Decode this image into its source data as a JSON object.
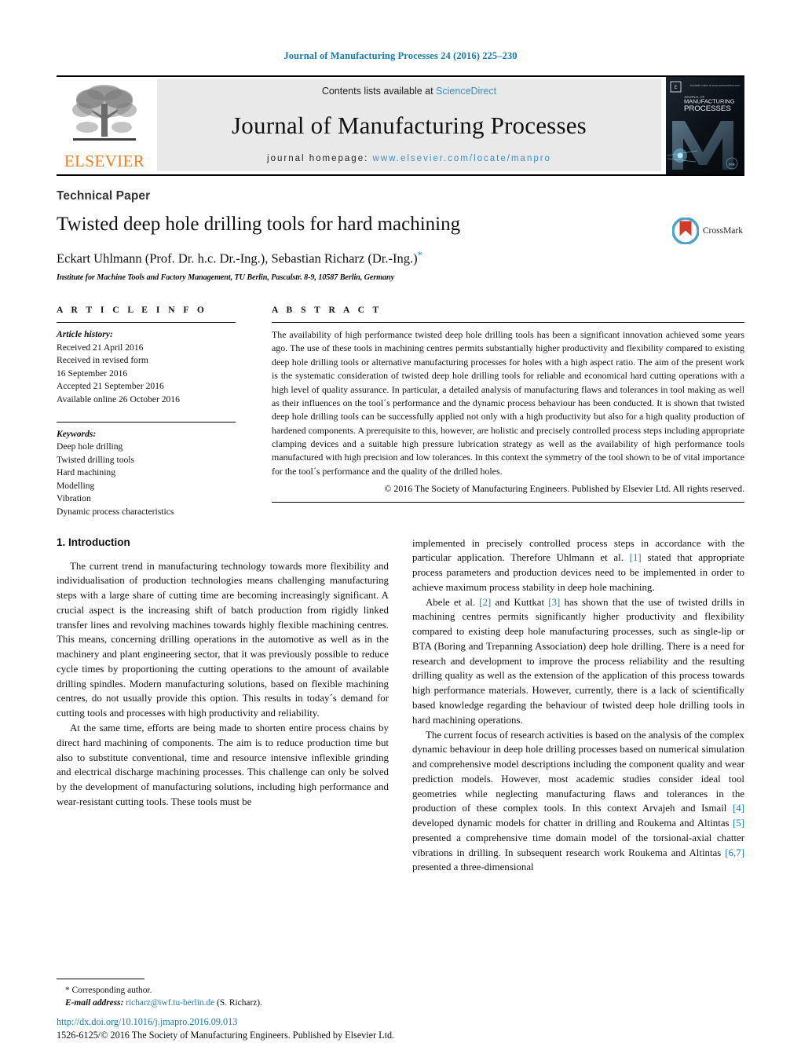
{
  "running_head": "Journal of Manufacturing Processes 24 (2016) 225–230",
  "banner": {
    "publisher_logo_name": "ELSEVIER",
    "contents_prefix": "Contents lists available at ",
    "contents_link": "ScienceDirect",
    "journal_name": "Journal of Manufacturing Processes",
    "homepage_prefix": "journal homepage: ",
    "homepage_url": "www.elsevier.com/locate/manpro",
    "cover_title_line1": "JOURNAL OF",
    "cover_title_line2": "MANUFACTURING",
    "cover_title_line3": "PROCESSES"
  },
  "article": {
    "type": "Technical Paper",
    "title": "Twisted deep hole drilling tools for hard machining",
    "authors": "Eckart Uhlmann (Prof. Dr. h.c. Dr.-Ing.), Sebastian Richarz (Dr.-Ing.)",
    "corresponding_marker": "*",
    "affiliation": "Institute for Machine Tools and Factory Management, TU Berlin, Pascalstr. 8-9, 10587 Berlin, Germany",
    "crossmark_label": "CrossMark"
  },
  "article_info": {
    "heading": "A R T I C L E   I N F O",
    "history_label": "Article history:",
    "history": [
      "Received 21 April 2016",
      "Received in revised form",
      "16 September 2016",
      "Accepted 21 September 2016",
      "Available online 26 October 2016"
    ],
    "keywords_label": "Keywords:",
    "keywords": [
      "Deep hole drilling",
      "Twisted drilling tools",
      "Hard machining",
      "Modelling",
      "Vibration",
      "Dynamic process characteristics"
    ]
  },
  "abstract": {
    "heading": "A B S T R A C T",
    "text": "The availability of high performance twisted deep hole drilling tools has been a significant innovation achieved some years ago. The use of these tools in machining centres permits substantially higher productivity and flexibility compared to existing deep hole drilling tools or alternative manufacturing processes for holes with a high aspect ratio. The aim of the present work is the systematic consideration of twisted deep hole drilling tools for reliable and economical hard cutting operations with a high level of quality assurance. In particular, a detailed analysis of manufacturing flaws and tolerances in tool making as well as their influences on the tool´s performance and the dynamic process behaviour has been conducted. It is shown that twisted deep hole drilling tools can be successfully applied not only with a high productivity but also for a high quality production of hardened components. A prerequisite to this, however, are holistic and precisely controlled process steps including appropriate clamping devices and a suitable high pressure lubrication strategy as well as the availability of high performance tools manufactured with high precision and low tolerances. In this context the symmetry of the tool shown to be of vital importance for the tool´s performance and the quality of the drilled holes.",
    "copyright": "© 2016 The Society of Manufacturing Engineers. Published by Elsevier Ltd. All rights reserved."
  },
  "body": {
    "section_title": "1. Introduction",
    "left_paragraphs": [
      "The current trend in manufacturing technology towards more flexibility and individualisation of production technologies means challenging manufacturing steps with a large share of cutting time are becoming increasingly significant. A crucial aspect is the increasing shift of batch production from rigidly linked transfer lines and revolving machines towards highly flexible machining centres. This means, concerning drilling operations in the automotive as well as in the machinery and plant engineering sector, that it was previously possible to reduce cycle times by proportioning the cutting operations to the amount of available drilling spindles. Modern manufacturing solutions, based on flexible machining centres, do not usually provide this option. This results in today´s demand for cutting tools and processes with high productivity and reliability.",
      "At the same time, efforts are being made to shorten entire process chains by direct hard machining of components. The aim is to reduce production time but also to substitute conventional, time and resource intensive inflexible grinding and electrical discharge machining processes. This challenge can only be solved by the development of manufacturing solutions, including high performance and wear-resistant cutting tools. These tools must be"
    ],
    "right_paragraphs": [
      {
        "indent": false,
        "runs": [
          {
            "t": "implemented in precisely controlled process steps in accordance with the particular application. Therefore Uhlmann et al. "
          },
          {
            "t": "[1]",
            "ref": true
          },
          {
            "t": " stated that appropriate process parameters and production devices need to be implemented in order to achieve maximum process stability in deep hole machining."
          }
        ]
      },
      {
        "indent": true,
        "runs": [
          {
            "t": "Abele et al. "
          },
          {
            "t": "[2]",
            "ref": true
          },
          {
            "t": " and Kuttkat "
          },
          {
            "t": "[3]",
            "ref": true
          },
          {
            "t": " has shown that the use of twisted drills in machining centres permits significantly higher productivity and flexibility compared to existing deep hole manufacturing processes, such as single-lip or BTA (Boring and Trepanning Association) deep hole drilling. There is a need for research and development to improve the process reliability and the resulting drilling quality as well as the extension of the application of this process towards high performance materials. However, currently, there is a lack of scientifically based knowledge regarding the behaviour of twisted deep hole drilling tools in hard machining operations."
          }
        ]
      },
      {
        "indent": true,
        "runs": [
          {
            "t": "The current focus of research activities is based on the analysis of the complex dynamic behaviour in deep hole drilling processes based on numerical simulation and comprehensive model descriptions including the component quality and wear prediction models. However, most academic studies consider ideal tool geometries while neglecting manufacturing flaws and tolerances in the production of these complex tools. In this context Arvajeh and Ismail "
          },
          {
            "t": "[4]",
            "ref": true
          },
          {
            "t": " developed dynamic models for chatter in drilling and Roukema and Altintas "
          },
          {
            "t": "[5]",
            "ref": true
          },
          {
            "t": " presented a comprehensive time domain model of the torsional-axial chatter vibrations in drilling. In subsequent research work Roukema and Altintas "
          },
          {
            "t": "[6,7]",
            "ref": true
          },
          {
            "t": " presented a three-dimensional"
          }
        ]
      }
    ]
  },
  "footnote": {
    "corresponding": "* Corresponding author.",
    "email_label": "E-mail address:",
    "email": "richarz@iwf.tu-berlin.de",
    "email_suffix": "(S. Richarz)."
  },
  "imprint": {
    "doi": "http://dx.doi.org/10.1016/j.jmapro.2016.09.013",
    "issn_line": "1526-6125/© 2016 The Society of Manufacturing Engineers. Published by Elsevier Ltd."
  },
  "colors": {
    "link_blue": "#1a7bb0",
    "sciencedirect_blue": "#3c8fc6",
    "elsevier_orange": "#f07d20",
    "banner_gray": "#e9e9e9"
  }
}
